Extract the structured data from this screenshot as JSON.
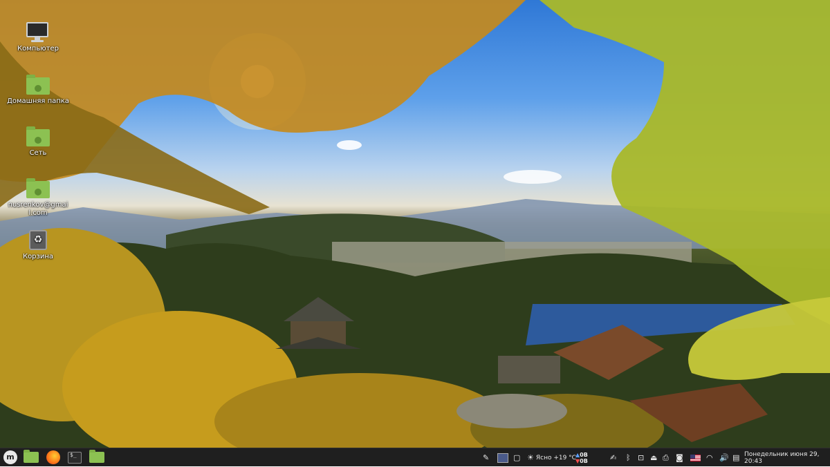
{
  "desktop": {
    "icons": [
      {
        "label": "Компьютер",
        "icon": "computer-icon"
      },
      {
        "label": "Домашняя папка",
        "icon": "home-folder-icon"
      },
      {
        "label": "Сеть",
        "icon": "network-icon"
      },
      {
        "label": "nusrenkov@gmail.com",
        "icon": "network-account-icon"
      },
      {
        "label": "Корзина",
        "icon": "trash-icon"
      }
    ]
  },
  "taskbar": {
    "launchers": [
      {
        "icon": "mint-menu-icon",
        "glyph": "m"
      },
      {
        "icon": "files-icon"
      },
      {
        "icon": "firefox-icon"
      },
      {
        "icon": "terminal-icon",
        "glyph": "$_"
      },
      {
        "icon": "files-icon"
      }
    ],
    "weather": {
      "glyph": "☀",
      "text": "Ясно +19 °C"
    },
    "network_speed": {
      "up": "0B",
      "down": "0B"
    },
    "tray_icons": [
      "color-picker-icon",
      "workspace-switcher-icon",
      "notes-icon",
      "weather-icon",
      "clipboard-icon",
      "bluetooth-icon",
      "update-icon",
      "removable-drive-icon",
      "printer-icon",
      "screenshot-icon",
      "keyboard-layout-icon",
      "wifi-icon",
      "volume-icon",
      "notifications-icon"
    ],
    "clock": "Понедельник июня 29, 20:43"
  }
}
